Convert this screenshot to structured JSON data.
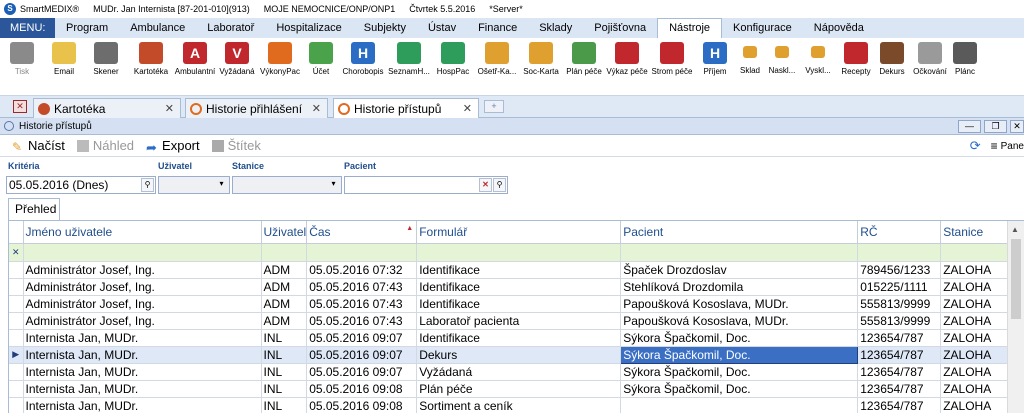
{
  "titlebar": {
    "app": "SmartMEDIX®",
    "user": "MUDr. Jan Internista [87-201-010](913)",
    "org": "MOJE NEMOCNICE/ONP/ONP1",
    "date": "Čtvrtek 5.5.2016",
    "server": "*Server*"
  },
  "menu": {
    "menu_label": "MENU:",
    "items": [
      "Program",
      "Ambulance",
      "Laboratoř",
      "Hospitalizace",
      "Subjekty",
      "Ústav",
      "Finance",
      "Sklady",
      "Pojišťovna",
      "Nástroje",
      "Konfigurace",
      "Nápověda"
    ],
    "active": "Nástroje"
  },
  "ribbon": {
    "buttons": [
      {
        "label": "Tisk",
        "icon": "printer-icon",
        "color": "#8a8a8a"
      },
      {
        "label": "Email",
        "icon": "envelope-icon",
        "color": "#e8c24a"
      },
      {
        "label": "Skener",
        "icon": "scanner-icon",
        "color": "#6d6d6d"
      },
      {
        "label": "Kartotéka",
        "icon": "people-icon",
        "color": "#c44b2a"
      },
      {
        "label": "Ambulantní",
        "icon": "letter-a-icon",
        "color": "#c0282d",
        "glyph": "A"
      },
      {
        "label": "Vyžádaná",
        "icon": "letter-v-icon",
        "color": "#c0282d",
        "glyph": "V"
      },
      {
        "label": "VýkonyPac",
        "icon": "bar-chart-icon",
        "color": "#e06b1f"
      },
      {
        "label": "Účet",
        "icon": "money-icon",
        "color": "#4aa34a"
      },
      {
        "label": "Chorobopis",
        "icon": "hospital-h-icon",
        "color": "#2b6cc4",
        "glyph": "H"
      },
      {
        "label": "SeznamH...",
        "icon": "bed-icon",
        "color": "#2e9c5a"
      },
      {
        "label": "HospPac",
        "icon": "bed-patient-icon",
        "color": "#2e9c5a"
      },
      {
        "label": "Ošetř-Ka...",
        "icon": "nurse-card-icon",
        "color": "#e0a030"
      },
      {
        "label": "Soc-Karta",
        "icon": "social-card-icon",
        "color": "#e0a030"
      },
      {
        "label": "Plán péče",
        "icon": "care-plan-icon",
        "color": "#4a9a4a"
      },
      {
        "label": "Výkaz péče",
        "icon": "care-report-icon",
        "color": "#c0282d"
      },
      {
        "label": "Strom péče",
        "icon": "care-tree-icon",
        "color": "#c0282d"
      },
      {
        "label": "Příjem",
        "icon": "admission-icon",
        "color": "#2b6cc4",
        "glyph": "H"
      },
      {
        "label": "Sklad",
        "icon": "storage-icon",
        "color": "#e0a030"
      },
      {
        "label": "Naskl...",
        "icon": "stock-in-icon",
        "color": "#e0a030"
      },
      {
        "label": "Vyskl...",
        "icon": "stock-out-icon",
        "color": "#e0a030"
      },
      {
        "label": "Recepty",
        "icon": "pills-icon",
        "color": "#c0282d"
      },
      {
        "label": "Dekurs",
        "icon": "bag-icon",
        "color": "#7a4a2a"
      },
      {
        "label": "Očkování",
        "icon": "syringe-icon",
        "color": "#9a9a9a"
      },
      {
        "label": "Plánc",
        "icon": "calendar-icon",
        "color": "#5a5a5a"
      }
    ]
  },
  "tabs": [
    {
      "label": "Kartotéka"
    },
    {
      "label": "Historie přihlášení"
    },
    {
      "label": "Historie přístupů"
    }
  ],
  "window": {
    "title": "Historie přístupů"
  },
  "toolbar": {
    "load": "Načíst",
    "preview": "Náhled",
    "export": "Export",
    "label": "Štítek",
    "panel": "Pane"
  },
  "filters": {
    "criteria_label": "Kritéria",
    "criteria_value": "05.05.2016 (Dnes)",
    "user_label": "Uživatel",
    "station_label": "Stanice",
    "patient_label": "Pacient"
  },
  "subtab": "Přehled",
  "grid": {
    "columns": [
      "Jméno uživatele",
      "Uživatel",
      "Čas",
      "Formulář",
      "Pacient",
      "RČ",
      "Stanice"
    ],
    "sorted_column": "Čas",
    "rows": [
      [
        "Administrátor Josef, Ing.",
        "ADM",
        "05.05.2016 07:32",
        "Identifikace",
        "Špaček Drozdoslav",
        "789456/1233",
        "ZALOHA"
      ],
      [
        "Administrátor Josef, Ing.",
        "ADM",
        "05.05.2016 07:43",
        "Identifikace",
        "Stehlíková Drozdomila",
        "015225/1111",
        "ZALOHA"
      ],
      [
        "Administrátor Josef, Ing.",
        "ADM",
        "05.05.2016 07:43",
        "Identifikace",
        "Papoušková Kososlava, MUDr.",
        "555813/9999",
        "ZALOHA"
      ],
      [
        "Administrátor Josef, Ing.",
        "ADM",
        "05.05.2016 07:43",
        "Laboratoř pacienta",
        "Papoušková Kososlava, MUDr.",
        "555813/9999",
        "ZALOHA"
      ],
      [
        "Internista Jan, MUDr.",
        "INL",
        "05.05.2016 09:07",
        "Identifikace",
        "Sýkora Špačkomil, Doc.",
        "123654/787",
        "ZALOHA"
      ],
      [
        "Internista Jan, MUDr.",
        "INL",
        "05.05.2016 09:07",
        "Dekurs",
        "Sýkora Špačkomil, Doc.",
        "123654/787",
        "ZALOHA"
      ],
      [
        "Internista Jan, MUDr.",
        "INL",
        "05.05.2016 09:07",
        "Vyžádaná",
        "Sýkora Špačkomil, Doc.",
        "123654/787",
        "ZALOHA"
      ],
      [
        "Internista Jan, MUDr.",
        "INL",
        "05.05.2016 09:08",
        "Plán péče",
        "Sýkora Špačkomil, Doc.",
        "123654/787",
        "ZALOHA"
      ],
      [
        "Internista Jan, MUDr.",
        "INL",
        "05.05.2016 09:08",
        "Sortiment a ceník",
        "",
        "123654/787",
        "ZALOHA"
      ]
    ],
    "selected_row": 5
  }
}
